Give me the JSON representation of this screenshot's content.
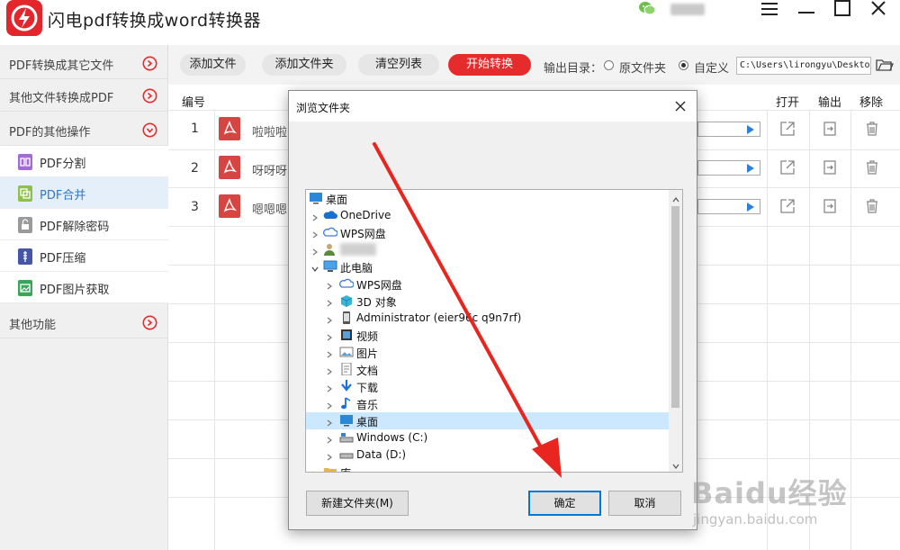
{
  "window": {
    "title": "闪电pdf转换成word转换器"
  },
  "sidebar": {
    "sections": [
      {
        "label": "PDF转换成其它文件"
      },
      {
        "label": "其他文件转换成PDF"
      },
      {
        "label": "PDF的其他操作"
      },
      {
        "label": "其他功能"
      }
    ],
    "items": [
      {
        "label": "PDF分割",
        "icon": "split-icon"
      },
      {
        "label": "PDF合并",
        "icon": "merge-icon"
      },
      {
        "label": "PDF解除密码",
        "icon": "unlock-icon"
      },
      {
        "label": "PDF压缩",
        "icon": "compress-icon"
      },
      {
        "label": "PDF图片获取",
        "icon": "image-extract-icon"
      }
    ],
    "active_item": "PDF合并"
  },
  "toolbar": {
    "add_file": "添加文件",
    "add_folder": "添加文件夹",
    "clear_list": "清空列表",
    "start_convert": "开始转换",
    "output_label": "输出目录：",
    "opt_original": "原文件夹",
    "opt_custom": "自定义",
    "output_path": "C:\\Users\\lirongyu\\Desktop"
  },
  "table": {
    "headers": {
      "num": "编号",
      "open": "打开",
      "output": "输出",
      "remove": "移除"
    },
    "rows": [
      {
        "num": "1",
        "name": "啦啦啦"
      },
      {
        "num": "2",
        "name": "呀呀呀"
      },
      {
        "num": "3",
        "name": "嗯嗯嗯"
      }
    ]
  },
  "dialog": {
    "title": "浏览文件夹",
    "tree": [
      {
        "label": "桌面",
        "icon": "desktop-icon"
      },
      {
        "label": "OneDrive",
        "icon": "cloud-icon"
      },
      {
        "label": "WPS网盘",
        "icon": "wps-cloud-icon"
      },
      {
        "label": "",
        "icon": "user-icon"
      },
      {
        "label": "此电脑",
        "icon": "computer-icon"
      },
      {
        "label": "WPS网盘",
        "icon": "wps-cloud-icon"
      },
      {
        "label": "3D 对象",
        "icon": "3d-objects-icon"
      },
      {
        "label": "Administrator (eier96c       q9n7rf)",
        "icon": "phone-icon"
      },
      {
        "label": "视频",
        "icon": "video-icon"
      },
      {
        "label": "图片",
        "icon": "pictures-icon"
      },
      {
        "label": "文档",
        "icon": "documents-icon"
      },
      {
        "label": "下载",
        "icon": "download-icon"
      },
      {
        "label": "音乐",
        "icon": "music-icon"
      },
      {
        "label": "桌面",
        "icon": "desktop-icon"
      },
      {
        "label": "Windows (C:)",
        "icon": "drive-c-icon"
      },
      {
        "label": "Data (D:)",
        "icon": "drive-icon"
      },
      {
        "label": "库",
        "icon": "library-icon"
      }
    ],
    "selected": "桌面",
    "new_folder": "新建文件夹(M)",
    "ok": "确定",
    "cancel": "取消"
  },
  "watermark": {
    "logo": "Baidu经验",
    "url": "jingyan.baidu.com"
  },
  "colors": {
    "accent_red": "#e52b2b",
    "selection_blue": "#cce8ff",
    "annotation_red": "#e8261f"
  }
}
